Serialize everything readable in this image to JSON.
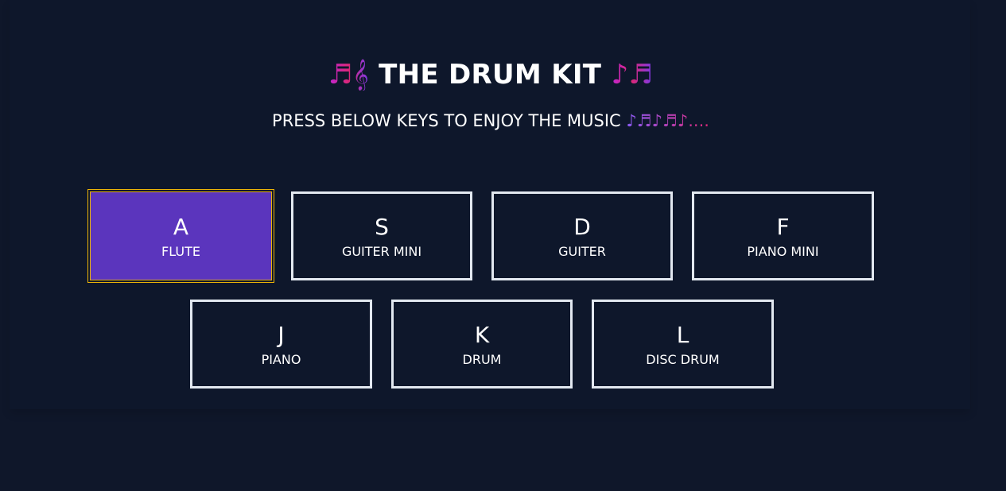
{
  "header": {
    "title_emoji_left": "♬𝄞",
    "title_text": "THE DRUM KIT",
    "title_emoji_right": "♪♬",
    "subtitle_text": "PRESS BELOW KEYS TO ENJOY THE MUSIC",
    "subtitle_emoji": "♪♬♪♬♪...."
  },
  "keys": [
    {
      "letter": "A",
      "sound": "FLUTE",
      "active": true
    },
    {
      "letter": "S",
      "sound": "GUITER MINI",
      "active": false
    },
    {
      "letter": "D",
      "sound": "GUITER",
      "active": false
    },
    {
      "letter": "F",
      "sound": "PIANO MINI",
      "active": false
    },
    {
      "letter": "J",
      "sound": "PIANO",
      "active": false
    },
    {
      "letter": "K",
      "sound": "DRUM",
      "active": false
    },
    {
      "letter": "L",
      "sound": "DISC DRUM",
      "active": false
    }
  ],
  "colors": {
    "background": "#0f172a",
    "active_key": "#5b35bd",
    "key_border": "#e2e8f0",
    "active_outline": "#eab308",
    "emoji_gradient": [
      "#c026d3",
      "#db2777",
      "#7c3aed"
    ]
  }
}
